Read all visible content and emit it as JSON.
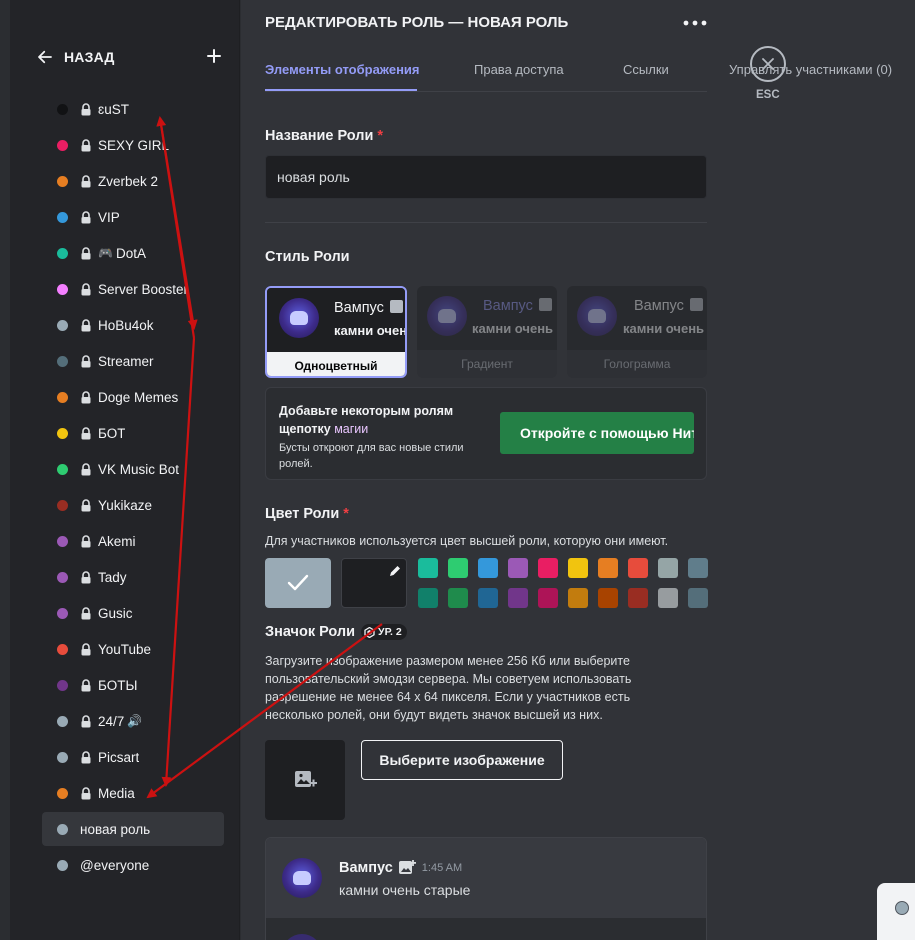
{
  "header": {
    "back_label": "НАЗАД",
    "title": "РЕДАКТИРОВАТЬ РОЛЬ — НОВАЯ РОЛЬ",
    "more": "•••"
  },
  "tabs": [
    {
      "label": "Элементы отображения"
    },
    {
      "label": "Права доступа"
    },
    {
      "label": "Ссылки"
    },
    {
      "label": "Управлять участниками (0)"
    }
  ],
  "esc_label": "ESC",
  "roles": [
    {
      "name": "ɛuST",
      "color": "#111214",
      "locked": true
    },
    {
      "name": "SEXY GIRL",
      "color": "#e91e63",
      "locked": true
    },
    {
      "name": "Zverbek 2",
      "color": "#e67e22",
      "locked": true
    },
    {
      "name": "VIP",
      "color": "#3498db",
      "locked": true
    },
    {
      "name": "DotA",
      "color": "#1abc9c",
      "locked": true,
      "prefix": "🎮"
    },
    {
      "name": "Server Booster",
      "color": "#f47fff",
      "locked": true
    },
    {
      "name": "HoBu4ok",
      "color": "#99aab5",
      "locked": true
    },
    {
      "name": "Streamer",
      "color": "#546e7a",
      "locked": true
    },
    {
      "name": "Doge Memes",
      "color": "#e67e22",
      "locked": true
    },
    {
      "name": "БОТ",
      "color": "#f1c40f",
      "locked": true
    },
    {
      "name": "VK Music Bot",
      "color": "#2ecc71",
      "locked": true
    },
    {
      "name": "Yukikaze",
      "color": "#992d22",
      "locked": true
    },
    {
      "name": "Akemi",
      "color": "#9b59b6",
      "locked": true
    },
    {
      "name": "Tady",
      "color": "#9b59b6",
      "locked": true
    },
    {
      "name": "Gusic",
      "color": "#9b59b6",
      "locked": true
    },
    {
      "name": "YouTube",
      "color": "#e74c3c",
      "locked": true
    },
    {
      "name": "БОТЫ",
      "color": "#71368a",
      "locked": true
    },
    {
      "name": "24/7",
      "color": "#99aab5",
      "locked": true,
      "suffix": "🔊"
    },
    {
      "name": "Picsart",
      "color": "#99aab5",
      "locked": true
    },
    {
      "name": "Media",
      "color": "#e67e22",
      "locked": true
    },
    {
      "name": "новая роль",
      "color": "#99aab5",
      "locked": false,
      "active": true
    },
    {
      "name": "@everyone",
      "color": "#99aab5",
      "locked": false
    }
  ],
  "role_name": {
    "label": "Название Роли",
    "required_mark": "*",
    "value": "новая роль"
  },
  "role_style": {
    "label": "Стиль Роли",
    "preview_name": "Вампус",
    "preview_msg": "камни очень",
    "cards": [
      {
        "label": "Одноцветный"
      },
      {
        "label": "Градиент"
      },
      {
        "label": "Голограмма"
      }
    ]
  },
  "boost": {
    "title_part1": "Добавьте некоторым ролям щепотку ",
    "title_magic": "магии",
    "subtitle": "Бусты откроют для вас новые стили ролей.",
    "button_label": "Откройте с помощью Нитро"
  },
  "role_color": {
    "label": "Цвет Роли",
    "required_mark": "*",
    "description": "Для участников используется цвет высшей роли, которую они имеют.",
    "default_color": "#99aab5",
    "swatches_top": [
      "#1abc9c",
      "#2ecc71",
      "#3498db",
      "#9b59b6",
      "#e91e63",
      "#f1c40f",
      "#e67e22",
      "#e74c3c",
      "#95a5a6",
      "#607d8b"
    ],
    "swatches_bottom": [
      "#11806a",
      "#1f8b4c",
      "#206694",
      "#71368a",
      "#ad1457",
      "#c27c0e",
      "#a84300",
      "#992d22",
      "#979c9f",
      "#546e7a"
    ]
  },
  "role_icon": {
    "label": "Значок Роли",
    "level_badge": "УР. 2",
    "description": "Загрузите изображение размером менее 256 Кб или выберите пользовательский эмодзи сервера. Мы советуем использовать разрешение не менее 64 x 64 пикселя. Если у участников есть несколько ролей, они будут видеть значок высшей из них.",
    "choose_button": "Выберите изображение"
  },
  "preview": {
    "name": "Вампус",
    "time": "1:45 AM",
    "message": "камни очень старые"
  },
  "colors": {
    "accent": "#949cf7",
    "boost_green": "#248046",
    "annotation_red": "#cc1111"
  }
}
